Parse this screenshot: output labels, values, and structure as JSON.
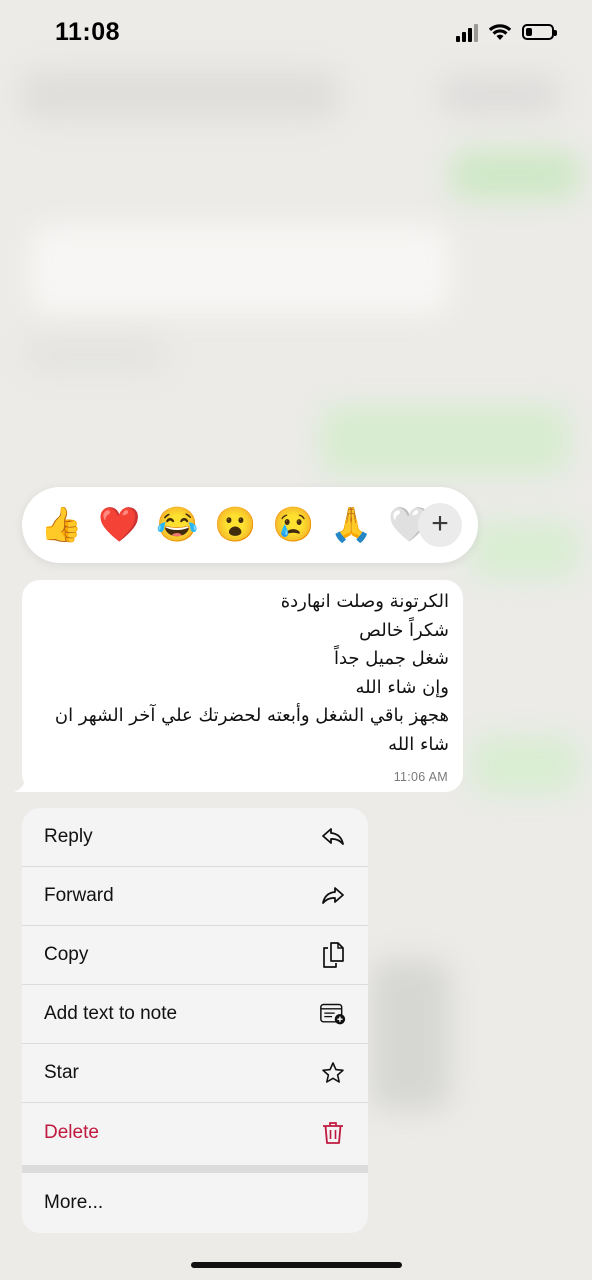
{
  "status_bar": {
    "time": "11:08"
  },
  "reactions": {
    "emojis": [
      "👍",
      "❤️",
      "😂",
      "😮",
      "😢",
      "🙏",
      "🤍"
    ],
    "more_label": "+"
  },
  "message": {
    "lines": [
      "الكرتونة وصلت انهاردة",
      "شكراً خالص",
      "شغل جميل جداً",
      "وإن شاء الله",
      "هجهز باقي الشغل وأبعته لحضرتك علي آخر الشهر ان",
      "شاء الله"
    ],
    "time": "11:06 AM"
  },
  "menu": {
    "items": [
      {
        "label": "Reply",
        "icon": "reply-icon"
      },
      {
        "label": "Forward",
        "icon": "forward-icon"
      },
      {
        "label": "Copy",
        "icon": "copy-icon"
      },
      {
        "label": "Add text to note",
        "icon": "note-add-icon"
      },
      {
        "label": "Star",
        "icon": "star-icon"
      },
      {
        "label": "Delete",
        "icon": "trash-icon"
      },
      {
        "label": "More...",
        "icon": ""
      }
    ]
  },
  "colors": {
    "delete": "#c0193f",
    "bubble": "#ffffff",
    "menu_bg": "#f4f4f4"
  }
}
